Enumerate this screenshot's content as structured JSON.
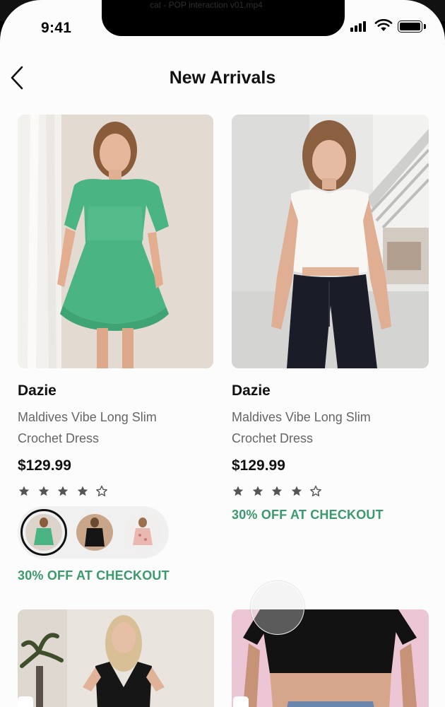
{
  "video_title": "cat - POP interaction v01.mp4",
  "status_bar": {
    "time": "9:41"
  },
  "nav": {
    "title": "New Arrivals",
    "back_icon": "chevron-left-icon"
  },
  "products": [
    {
      "brand": "Dazie",
      "name_line1": "Maldives Vibe Long Slim",
      "name_line2": "Crochet Dress",
      "price": "$129.99",
      "rating": 4,
      "promo": "30% OFF AT CHECKOUT",
      "image": "woman-in-green-dress-photo"
    },
    {
      "brand": "Dazie",
      "name_line1": "Maldives Vibe Long Slim",
      "name_line2": "Crochet Dress",
      "price": "$129.99",
      "rating": 4,
      "promo": "30% OFF AT CHECKOUT",
      "image": "woman-in-white-top-photo"
    }
  ],
  "swatches": [
    "green-dress",
    "black-dress",
    "pink-floral-dress"
  ],
  "colors": {
    "promo": "#3b9a6d",
    "text": "#111111",
    "muted": "#666666",
    "star": "#555555"
  }
}
